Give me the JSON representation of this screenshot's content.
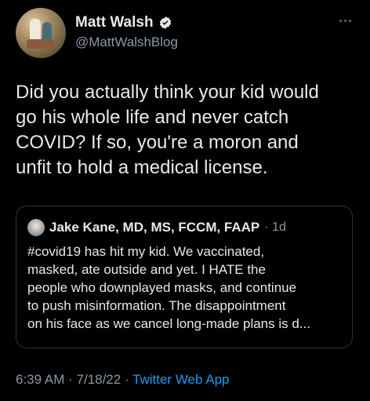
{
  "author": {
    "display_name": "Matt Walsh",
    "handle": "@MattWalshBlog",
    "verified_icon": "verified-badge-icon"
  },
  "tweet": {
    "text": "Did you actually think your kid would\ngo his whole life and never catch\nCOVID? If so, you're a moron and\nunfit to hold a medical license."
  },
  "quoted_tweet": {
    "display_name": "Jake Kane, MD, MS, FCCM, FAAP",
    "time": "· 1d",
    "text": "#covid19 has hit my kid. We vaccinated,\nmasked, ate outside and yet. I HATE the\npeople who downplayed masks, and continue\nto push misinformation. The disappointment\non his face as we cancel long-made plans is d..."
  },
  "meta": {
    "time": "6:39 AM",
    "sep1": " · ",
    "date": "7/18/22",
    "sep2": " · ",
    "app": "Twitter Web App"
  },
  "colors": {
    "background": "#000000",
    "text": "#e7e9ea",
    "secondary": "#8b98a5",
    "accent": "#1d9bf0",
    "border": "#2f3336"
  }
}
